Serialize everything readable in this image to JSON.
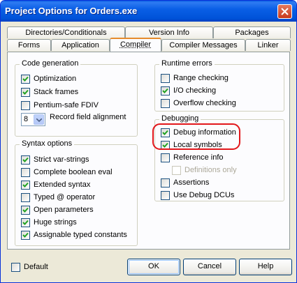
{
  "window": {
    "title": "Project Options for Orders.exe"
  },
  "tabs": {
    "row1": [
      "Directories/Conditionals",
      "Version Info",
      "Packages"
    ],
    "row2": [
      "Forms",
      "Application",
      "Compiler",
      "Compiler Messages",
      "Linker"
    ],
    "active": "Compiler"
  },
  "code_generation": {
    "title": "Code generation",
    "items": [
      {
        "label": "Optimization",
        "checked": true
      },
      {
        "label": "Stack frames",
        "checked": true
      },
      {
        "label": "Pentium-safe FDIV",
        "checked": false
      }
    ],
    "record_alignment": {
      "value": "8",
      "label": "Record field alignment"
    }
  },
  "syntax_options": {
    "title": "Syntax options",
    "items": [
      {
        "label": "Strict var-strings",
        "checked": true
      },
      {
        "label": "Complete boolean eval",
        "checked": false
      },
      {
        "label": "Extended syntax",
        "checked": true
      },
      {
        "label": "Typed @ operator",
        "checked": false
      },
      {
        "label": "Open parameters",
        "checked": true
      },
      {
        "label": "Huge strings",
        "checked": true
      },
      {
        "label": "Assignable typed constants",
        "checked": true
      }
    ]
  },
  "runtime_errors": {
    "title": "Runtime errors",
    "items": [
      {
        "label": "Range checking",
        "checked": false
      },
      {
        "label": "I/O checking",
        "checked": true
      },
      {
        "label": "Overflow checking",
        "checked": false
      }
    ]
  },
  "debugging": {
    "title": "Debugging",
    "items": [
      {
        "label": "Debug information",
        "checked": true
      },
      {
        "label": "Local symbols",
        "checked": true
      },
      {
        "label": "Reference info",
        "checked": false
      },
      {
        "label": "Definitions only",
        "checked": false,
        "disabled": true
      },
      {
        "label": "Assertions",
        "checked": false
      },
      {
        "label": "Use Debug DCUs",
        "checked": false
      }
    ]
  },
  "footer": {
    "default_label": "Default",
    "default_checked": false,
    "ok": "OK",
    "cancel": "Cancel",
    "help": "Help"
  },
  "colors": {
    "accent": "#0a5ee3",
    "highlight": "#e2161a"
  }
}
